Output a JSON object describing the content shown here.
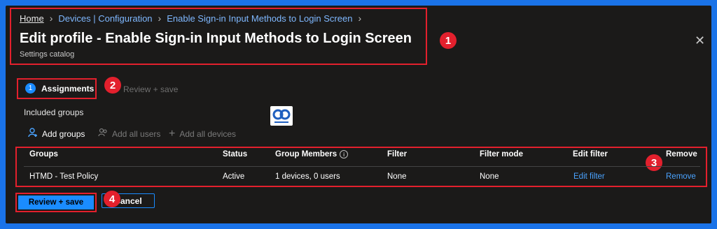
{
  "breadcrumb": {
    "home": "Home",
    "devices": "Devices | Configuration",
    "profile": "Enable Sign-in Input Methods to Login Screen"
  },
  "header": {
    "title": "Edit profile - Enable Sign-in Input Methods to Login Screen",
    "subtitle": "Settings catalog"
  },
  "tabs": {
    "assignments_number": "1",
    "assignments_label": "Assignments",
    "review_label": "Review + save"
  },
  "groups_section": {
    "included_label": "Included groups",
    "commands": {
      "add_groups": "Add groups",
      "add_all_users": "Add all users",
      "add_all_devices": "Add all devices"
    }
  },
  "table": {
    "headers": {
      "groups": "Groups",
      "status": "Status",
      "group_members": "Group Members",
      "filter": "Filter",
      "filter_mode": "Filter mode",
      "edit_filter": "Edit filter",
      "remove": "Remove"
    },
    "rows": [
      {
        "group": "HTMD - Test Policy",
        "status": "Active",
        "members": "1 devices, 0 users",
        "filter": "None",
        "filter_mode": "None",
        "edit_filter": "Edit filter",
        "remove": "Remove"
      }
    ]
  },
  "footer": {
    "review_save": "Review + save",
    "cancel": "Cancel"
  },
  "callouts": [
    "1",
    "2",
    "3",
    "4"
  ],
  "colors": {
    "background": "#1b1a19",
    "outer_border": "#1a73e8",
    "accent": "#1a8cff",
    "link": "#4aa3ff",
    "callout_red": "#e3202d"
  }
}
